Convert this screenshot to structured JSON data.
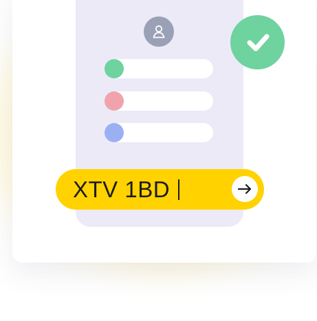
{
  "form_card": {
    "avatar_icon": "user-icon",
    "fields": [
      {
        "name": "green",
        "color": "#6ed39f"
      },
      {
        "name": "pink",
        "color": "#f0a3ab"
      },
      {
        "name": "blue",
        "color": "#9ab0f3"
      }
    ]
  },
  "status": {
    "icon": "check-icon",
    "color": "#6ed39f"
  },
  "code_input": {
    "value": "XTV 1BD",
    "submit_icon": "arrow-right-icon",
    "accent": "#ffd200"
  }
}
